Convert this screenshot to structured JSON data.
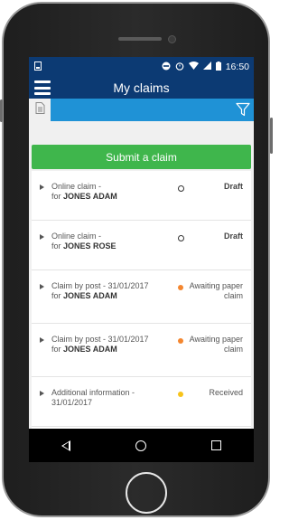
{
  "status_bar": {
    "time": "16:50"
  },
  "app_bar": {
    "title": "My claims",
    "menu_icon": "hamburger-menu-icon"
  },
  "filter_bar": {
    "tab_icon": "document-icon",
    "filter_icon": "filter-icon"
  },
  "submit_button": {
    "label": "Submit a claim",
    "color": "#3fb64c"
  },
  "colors": {
    "primary": "#0c3a73",
    "accent": "#1f92d6",
    "orange": "#f4862f",
    "yellow": "#f7c31a"
  },
  "claims": [
    {
      "title": "Online claim -",
      "for_prefix": "for",
      "name": "JONES ADAM",
      "indicator": "hollow",
      "status": "Draft"
    },
    {
      "title": "Online claim -",
      "for_prefix": "for",
      "name": "JONES ROSE",
      "indicator": "hollow",
      "status": "Draft"
    },
    {
      "title": "Claim by post - 31/01/2017",
      "for_prefix": "for",
      "name": "JONES ADAM",
      "indicator": "orange",
      "status": "Awaiting paper claim"
    },
    {
      "title": "Claim by post - 31/01/2017",
      "for_prefix": "for",
      "name": "JONES ADAM",
      "indicator": "orange",
      "status": "Awaiting paper claim"
    },
    {
      "title": "Additional information - 31/01/2017",
      "for_prefix": "",
      "name": "",
      "indicator": "yellow",
      "status": "Received"
    }
  ],
  "nav_bar": {
    "back": "back-triangle-icon",
    "home": "home-circle-icon",
    "recent": "recent-apps-square-icon"
  }
}
